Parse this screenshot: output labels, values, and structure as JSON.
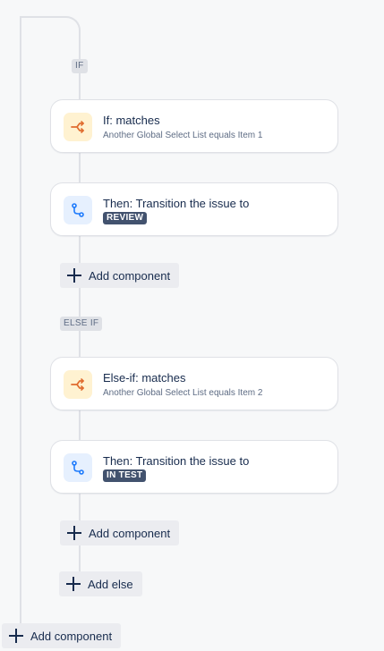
{
  "branches": {
    "if_tag": "IF",
    "else_if_tag": "ELSE IF"
  },
  "if_branch": {
    "condition": {
      "icon": "branch-condition-icon",
      "title": "If: matches",
      "subtitle": "Another Global Select List equals Item 1"
    },
    "action": {
      "icon": "transition-icon",
      "title": "Then: Transition the issue to",
      "status": "REVIEW"
    },
    "add_component_label": "Add component"
  },
  "else_if_branch": {
    "condition": {
      "icon": "branch-condition-icon",
      "title": "Else-if: matches",
      "subtitle": "Another Global Select List equals Item 2"
    },
    "action": {
      "icon": "transition-icon",
      "title": "Then: Transition the issue to",
      "status": "IN TEST"
    },
    "add_component_label": "Add component"
  },
  "add_else_label": "Add else",
  "root_add_component_label": "Add component",
  "colors": {
    "condition_icon": "#e06c2f",
    "action_icon": "#1d7afc",
    "connector": "#dfe1e6"
  }
}
